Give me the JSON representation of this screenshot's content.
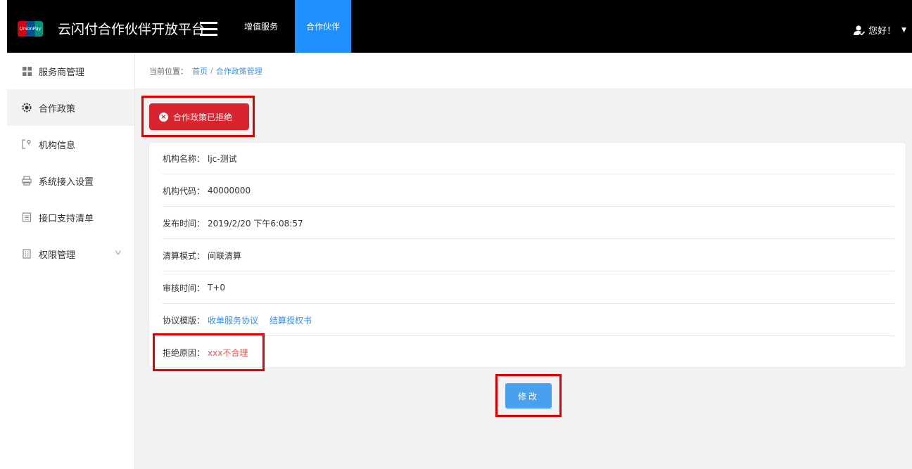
{
  "header": {
    "logo_text": "UnionPay",
    "title": "云闪付合作伙伴开放平台",
    "tabs": [
      {
        "label": "增值服务",
        "active": false
      },
      {
        "label": "合作伙伴",
        "active": true
      }
    ],
    "greeting": "您好！"
  },
  "sidebar": {
    "items": [
      {
        "label": "服务商管理",
        "icon": "grid-icon"
      },
      {
        "label": "合作政策",
        "icon": "gear-icon",
        "active": true
      },
      {
        "label": "机构信息",
        "icon": "bracket-icon"
      },
      {
        "label": "系统接入设置",
        "icon": "printer-icon"
      },
      {
        "label": "接口支持清单",
        "icon": "document-icon"
      },
      {
        "label": "权限管理",
        "icon": "building-icon",
        "has_submenu": true
      }
    ]
  },
  "breadcrumb": {
    "label": "当前位置：",
    "home": "首页",
    "separator": "/",
    "current": "合作政策管理"
  },
  "status": {
    "label": "合作政策已拒绝",
    "icon": "x-circle-icon"
  },
  "details": {
    "org_name_label": "机构名称：",
    "org_name": "ljc-测试",
    "org_code_label": "机构代码：",
    "org_code": "40000000",
    "publish_time_label": "发布时间：",
    "publish_time": "2019/2/20 下午6:08:57",
    "settlement_label": "清算模式：",
    "settlement": "间联清算",
    "audit_time_label": "审核时间：",
    "audit_time": "T+0",
    "template_label": "协议模版：",
    "template_links": [
      "收单服务协议",
      "结算授权书"
    ],
    "reject_reason_label": "拒绝原因：",
    "reject_reason": "xxx不合理"
  },
  "actions": {
    "edit_label": "修改"
  },
  "colors": {
    "header_bg": "#000000",
    "active_tab": "#1e90ff",
    "status_red": "#d9232d",
    "link_blue": "#3a8ee6",
    "edit_button": "#47a0f0",
    "annotation_red": "#e00000"
  }
}
